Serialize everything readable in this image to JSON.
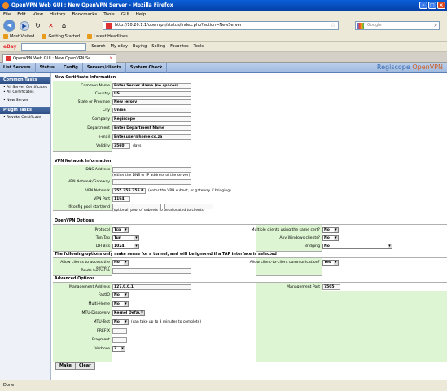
{
  "window": {
    "title": "OpenVPN Web GUI : New OpenVPN Server - Mozilla Firefox"
  },
  "menu": [
    "File",
    "Edit",
    "View",
    "History",
    "Bookmarks",
    "Tools",
    "GUI",
    "Help"
  ],
  "nav": {
    "url": "http://10.20.1.1/openvpn/status/index.php?action=NewServer",
    "search_placeholder": "Google"
  },
  "bookmarks": [
    "Most Visited",
    "Getting Started",
    "Latest Headlines"
  ],
  "ebay_toolbar": {
    "logo": "eBay",
    "items": [
      "Search",
      "My eBay",
      "Buying",
      "Selling",
      "Favorites",
      "Tools"
    ]
  },
  "tab": {
    "title": "OpenVPN Web GUI : New OpenVPN Se..."
  },
  "app_tabs": [
    "List Servers",
    "Status",
    "Config",
    "Servers/clients",
    "System Check"
  ],
  "brand": {
    "prefix": "Regiscope",
    "suffix": "OpenVPN"
  },
  "sidebar": {
    "common_title": "Common Tasks",
    "common_items": [
      "All Server Certificates",
      "All Certificates",
      "New Server"
    ],
    "plugin_title": "Plugin Tasks",
    "plugin_items": [
      "Revoke Certificate"
    ]
  },
  "cert": {
    "title": "New Certificate Information",
    "common_name": {
      "label": "Common Name",
      "value": "Enter Server Name (no spaces)"
    },
    "country": {
      "label": "Country",
      "value": "US"
    },
    "state": {
      "label": "State or Province",
      "value": "New Jersey"
    },
    "city": {
      "label": "City",
      "value": "Union"
    },
    "company": {
      "label": "Company",
      "value": "Regiscope"
    },
    "department": {
      "label": "Department",
      "value": "Enter Department Name"
    },
    "email": {
      "label": "e-mail",
      "value": "Enter.user@home.co.za"
    },
    "validity": {
      "label": "Validity",
      "value": "3560",
      "unit": "days"
    }
  },
  "network": {
    "title": "VPN Network Information",
    "dns": {
      "label": "DNS Address",
      "value": "",
      "note": "(either the DNS or IP address of the server)"
    },
    "gateway": {
      "label": "VPN Network/Gateway",
      "value": ""
    },
    "vpn_network": {
      "label": "VPN Network",
      "value": "255.255.255.0",
      "note": "(enter the VPN subnet, or gateway if bridging)"
    },
    "port": {
      "label": "VPN Port",
      "value": "1194"
    },
    "pool": {
      "label": "Ifconfig pool start/end",
      "value_start": "",
      "value_end": "",
      "note": "(optional, pool of subnets to be allocated to clients)"
    }
  },
  "openvpn": {
    "title": "OpenVPN Options",
    "protocol": {
      "label": "Protocol",
      "value": "Tcp"
    },
    "tun_tap": {
      "label": "Tun/Tap",
      "value": "Tun"
    },
    "dh_bits": {
      "label": "DH Bits",
      "value": "1024"
    },
    "multi_clients": {
      "label": "Multiple clients using the same cert?",
      "value": "No"
    },
    "windows_clients": {
      "label": "Any Windows clients?",
      "value": "No"
    },
    "bridging": {
      "label": "Bridging",
      "value": "No"
    }
  },
  "tunnel": {
    "title": "The following options only make sense for a tunnel, and will be ignored if a TAP interface is selected",
    "allow_server": {
      "label": "Allow clients to access the server?",
      "value": "No"
    },
    "allow_clients": {
      "label": "Allow client-to-client communication?",
      "value": "Yes"
    },
    "route": {
      "label": "Route tunnel to",
      "value": ""
    }
  },
  "advanced": {
    "title": "Advanced Options",
    "mgmt_addr": {
      "label": "Management Address",
      "value": "127.0.0.1"
    },
    "mgmt_port": {
      "label": "Management Port",
      "value": "7505"
    },
    "fast_io": {
      "label": "FastIO",
      "value": "No"
    },
    "multihome": {
      "label": "Multi-Home",
      "value": "No"
    },
    "mtu_discovery": {
      "label": "MTU-Discovery",
      "value": "Kernel Default"
    },
    "mtu_test": {
      "label": "MTU-Test",
      "value": "No",
      "note": "(can take up to 3 minutes to complete)"
    },
    "prefix": {
      "label": "PREFIX",
      "value": ""
    },
    "fragment": {
      "label": "Fragment",
      "value": ""
    },
    "verbose": {
      "label": "Verbose",
      "value": "3"
    }
  },
  "buttons": {
    "make": "Make",
    "clear": "Clear"
  },
  "status": "Done"
}
